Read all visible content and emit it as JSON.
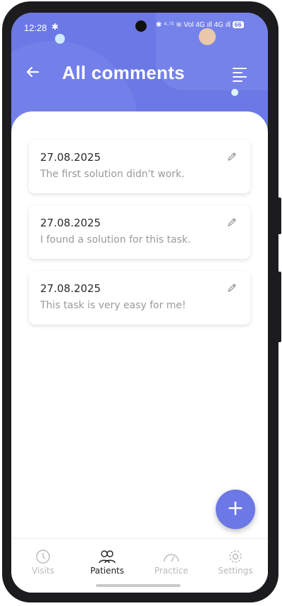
{
  "status_bar": {
    "time": "12:28",
    "bluetooth_icon": "bluetooth-icon",
    "indicators": "✱ ⁴·⁷¹ ≋ Vol 4G ıll 4G ıll",
    "battery": "66"
  },
  "header": {
    "title": "All comments",
    "back_icon": "arrow-left-icon",
    "menu_icon": "menu-lines-icon",
    "accent_color": "#6b78e5"
  },
  "comments": [
    {
      "date": "27.08.2025",
      "text": "The first solution didn't work.",
      "edit_icon": "pencil-icon"
    },
    {
      "date": "27.08.2025",
      "text": "I found a solution for this task.",
      "edit_icon": "pencil-icon"
    },
    {
      "date": "27.08.2025",
      "text": "This task is very easy for me!",
      "edit_icon": "pencil-icon"
    }
  ],
  "fab": {
    "label": "+",
    "icon": "plus-icon"
  },
  "bottom_nav": {
    "items": [
      {
        "label": "Visits",
        "icon": "clock-history-icon",
        "active": false
      },
      {
        "label": "Patients",
        "icon": "people-icon",
        "active": true
      },
      {
        "label": "Practice",
        "icon": "gauge-icon",
        "active": false
      },
      {
        "label": "Settings",
        "icon": "gear-icon",
        "active": false
      }
    ]
  }
}
